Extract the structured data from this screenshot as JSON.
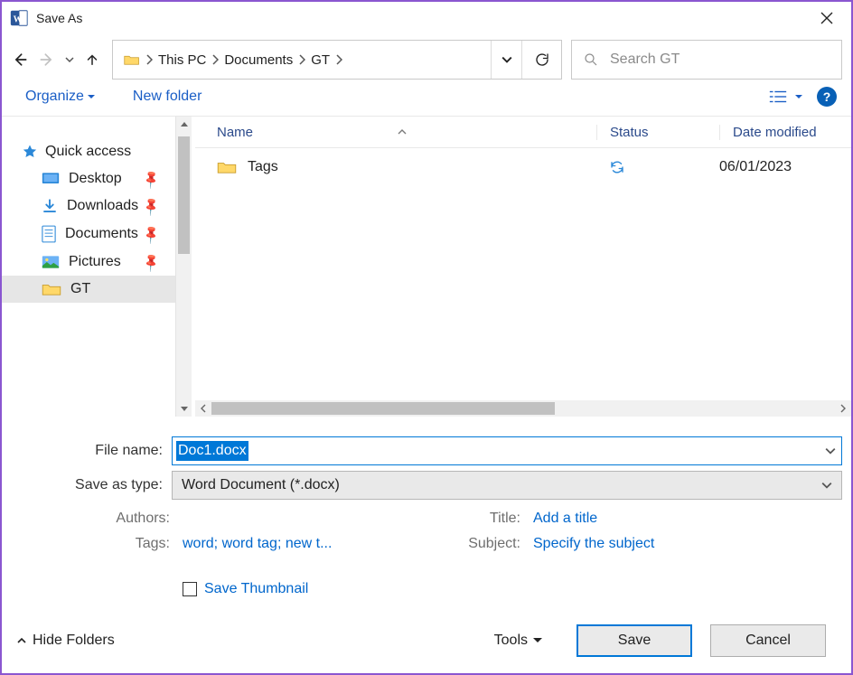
{
  "window": {
    "title": "Save As"
  },
  "breadcrumb": {
    "root": "This PC",
    "p1": "Documents",
    "p2": "GT"
  },
  "search": {
    "placeholder": "Search GT"
  },
  "toolbar": {
    "organize": "Organize",
    "new_folder": "New folder"
  },
  "sidebar": {
    "quick_access": "Quick access",
    "items": [
      {
        "label": "Desktop"
      },
      {
        "label": "Downloads"
      },
      {
        "label": "Documents"
      },
      {
        "label": "Pictures"
      },
      {
        "label": "GT"
      }
    ]
  },
  "columns": {
    "name": "Name",
    "status": "Status",
    "date": "Date modified"
  },
  "files": [
    {
      "name": "Tags",
      "date": "06/01/2023"
    }
  ],
  "form": {
    "filename_label": "File name:",
    "filename_value": "Doc1.docx",
    "type_label": "Save as type:",
    "type_value": "Word Document (*.docx)"
  },
  "meta": {
    "authors_label": "Authors:",
    "tags_label": "Tags:",
    "tags_value": "word; word tag; new t...",
    "title_label": "Title:",
    "title_value": "Add a title",
    "subject_label": "Subject:",
    "subject_value": "Specify the subject"
  },
  "thumbnail": {
    "label": "Save Thumbnail"
  },
  "footer": {
    "hide": "Hide Folders",
    "tools": "Tools",
    "save": "Save",
    "cancel": "Cancel"
  }
}
